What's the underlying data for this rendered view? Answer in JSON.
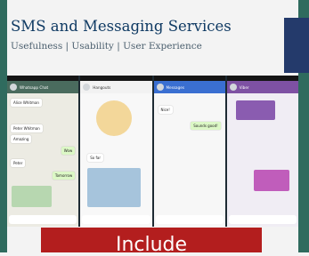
{
  "slide": {
    "title": "SMS and Messaging Services",
    "subtitle": "Usefulness | Usability | User Experience",
    "caption": "Include"
  },
  "screenshots": [
    {
      "app": "whatsapp",
      "header_color": "#4a6b5e",
      "header_title": "Whatsapp Chat",
      "header_subtitle": "",
      "message_labels": [
        "Alice Whitman",
        "Peter Whitman",
        "Amazing",
        "Wow",
        "Peter",
        "Tomorrow"
      ]
    },
    {
      "app": "hangouts",
      "header_color": "#f2f2f2",
      "header_title": "Hangouts",
      "message_labels": [
        "So far"
      ]
    },
    {
      "app": "messages",
      "header_color": "#3a6fd1",
      "header_title": "Messages",
      "message_labels": [
        "Nice!",
        "Sounds good!"
      ]
    },
    {
      "app": "viber",
      "header_color": "#7e51a3",
      "header_title": "Viber",
      "message_labels": []
    }
  ],
  "colors": {
    "frame": "#2f6b5e",
    "title": "#0f3a63",
    "caption_bg": "#b31e1e"
  }
}
